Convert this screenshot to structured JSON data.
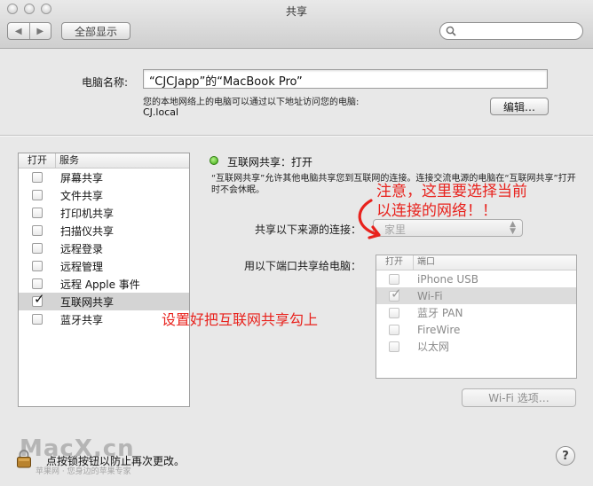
{
  "window": {
    "title": "共享"
  },
  "toolbar": {
    "back_glyph": "◀",
    "forward_glyph": "▶",
    "show_all_label": "全部显示",
    "search_placeholder": ""
  },
  "computer_name": {
    "label": "电脑名称:",
    "value": "“CJCJapp”的“MacBook Pro”",
    "access_note": "您的本地网络上的电脑可以通过以下地址访问您的电脑:",
    "local_hostname": "CJ.local",
    "edit_label": "编辑…"
  },
  "services": {
    "col_on": "打开",
    "col_service": "服务",
    "items": [
      {
        "label": "屏幕共享",
        "checked": false,
        "selected": false
      },
      {
        "label": "文件共享",
        "checked": false,
        "selected": false
      },
      {
        "label": "打印机共享",
        "checked": false,
        "selected": false
      },
      {
        "label": "扫描仪共享",
        "checked": false,
        "selected": false
      },
      {
        "label": "远程登录",
        "checked": false,
        "selected": false
      },
      {
        "label": "远程管理",
        "checked": false,
        "selected": false
      },
      {
        "label": "远程 Apple 事件",
        "checked": false,
        "selected": false
      },
      {
        "label": "互联网共享",
        "checked": true,
        "selected": true
      },
      {
        "label": "蓝牙共享",
        "checked": false,
        "selected": false
      }
    ]
  },
  "internet_sharing": {
    "status": "互联网共享：打开",
    "status_color": "#3aa80d",
    "description": "“互联网共享”允许其他电脑共享您到互联网的连接。连接交流电源的电脑在“互联网共享”打开时不会休眠。",
    "share_from_label": "共享以下来源的连接：",
    "share_from_value": "家里",
    "share_to_label": "用以下端口共享给电脑：",
    "ports_col_on": "打开",
    "ports_col_port": "端口",
    "ports": [
      {
        "label": "iPhone USB",
        "checked": false,
        "selected": false
      },
      {
        "label": "Wi-Fi",
        "checked": true,
        "selected": true
      },
      {
        "label": "蓝牙 PAN",
        "checked": false,
        "selected": false
      },
      {
        "label": "FireWire",
        "checked": false,
        "selected": false
      },
      {
        "label": "以太网",
        "checked": false,
        "selected": false
      }
    ],
    "wifi_options_label": "Wi-Fi 选项…"
  },
  "annotations": {
    "note_source_line1": "注意，这里要选择当前",
    "note_source_line2": "以连接的网络！！",
    "note_checkbox": "设置好把互联网共享勾上",
    "color": "#e8221d"
  },
  "footer": {
    "lock_text": "点按锁按钮以防止再次更改。",
    "help_glyph": "?"
  },
  "watermark": {
    "brand": "MacX.cn",
    "slogan": "苹果网 · 您身边的苹果专家"
  }
}
